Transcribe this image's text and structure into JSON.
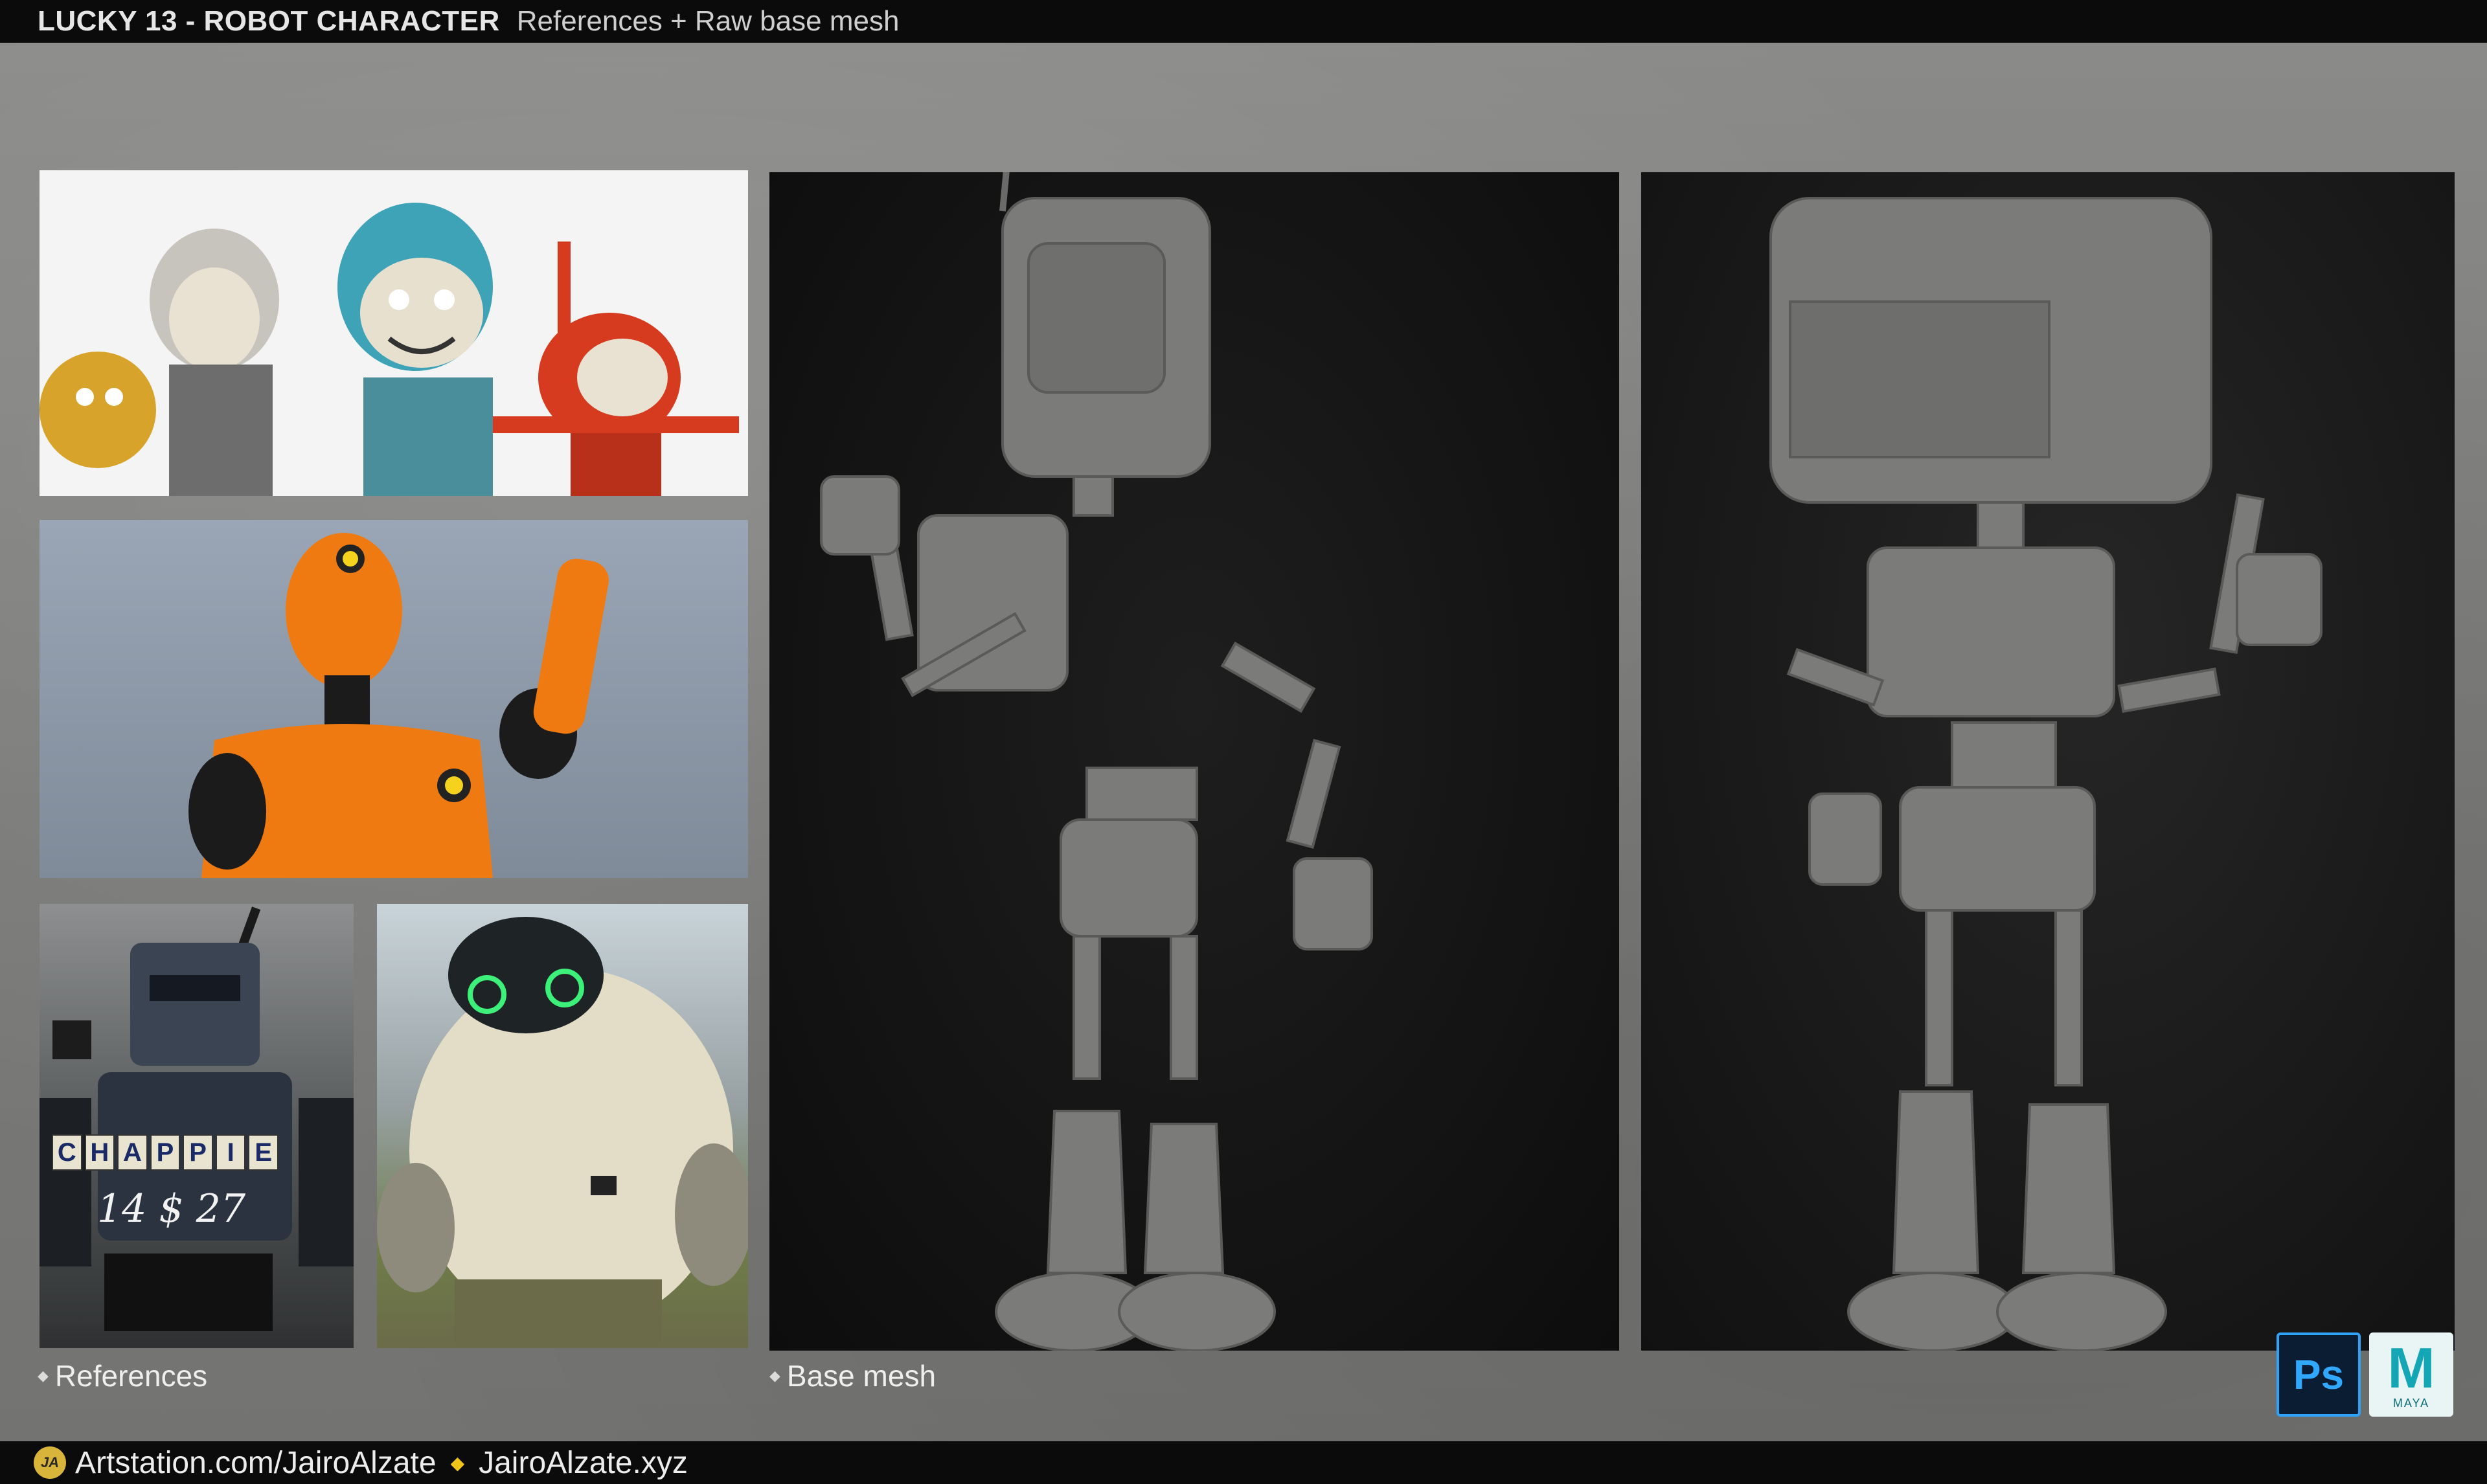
{
  "header": {
    "title": "LUCKY 13 - ROBOT CHARACTER",
    "subtitle": "References + Raw base mesh"
  },
  "labels": {
    "references": "References",
    "base_mesh": "Base mesh"
  },
  "reference_text": {
    "chappie_letters": [
      "C",
      "H",
      "A",
      "P",
      "P",
      "I",
      "E"
    ],
    "sign": "14 $ 27"
  },
  "footer": {
    "logo_text": "JA",
    "artstation": "Artstation.com/JairoAlzate",
    "website": "JairoAlzate.xyz"
  },
  "badges": {
    "photoshop": "Ps",
    "maya_letter": "M",
    "maya_text": "MAYA"
  },
  "colors": {
    "crash_dummy_orange": "#f07a12",
    "robot_teal": "#3fa3b8",
    "robot_red": "#d63a1f",
    "eye_green": "#3cf07a",
    "mesh_gray": "#7b7b79"
  }
}
